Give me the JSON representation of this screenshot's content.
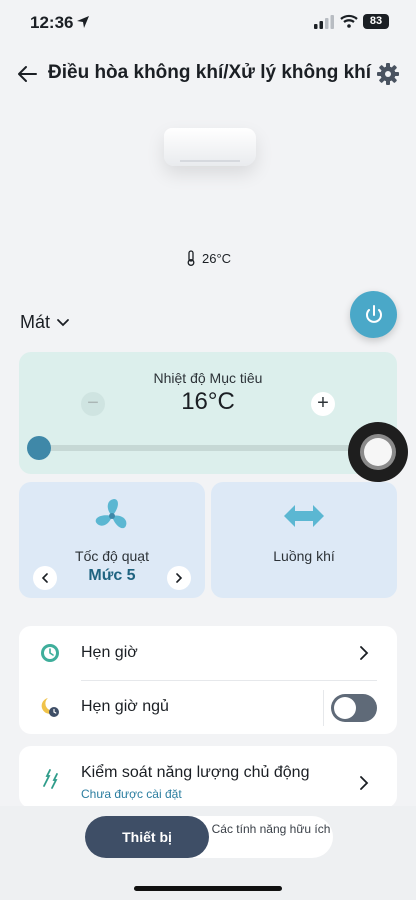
{
  "status_bar": {
    "time": "12:36",
    "battery": "83"
  },
  "header": {
    "title": "Điều hòa không khí/Xử lý không khí"
  },
  "room": {
    "temperature": "26°C"
  },
  "mode": {
    "label": "Mát"
  },
  "target_temp": {
    "label": "Nhiệt độ Mục tiêu",
    "value": "16°C",
    "minus": "−",
    "plus": "+",
    "slider_level": 0.0
  },
  "fan": {
    "label": "Tốc độ quạt",
    "value": "Mức 5"
  },
  "airflow": {
    "label": "Luồng khí"
  },
  "list": {
    "timer": "Hẹn giờ",
    "sleep_timer": "Hẹn giờ ngủ",
    "sleep_timer_on": false,
    "energy": "Kiểm soát năng lượng chủ động",
    "energy_status": "Chưa được cài đặt"
  },
  "bottom_tabs": {
    "device": "Thiết bị",
    "features": "Các tính năng hữu ích"
  },
  "colors": {
    "accent": "#4aa8c8",
    "temp_card": "#dcefec",
    "fan_card": "#dde9f6",
    "active_tab": "#3e4e66"
  }
}
